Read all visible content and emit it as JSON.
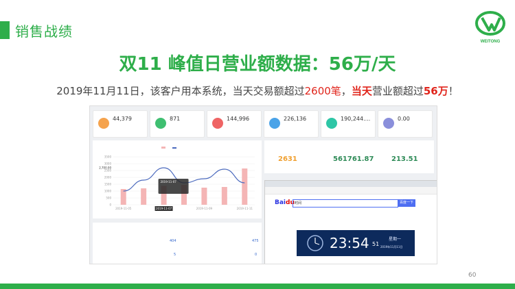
{
  "header": {
    "title": "销售战绩"
  },
  "logo": {
    "text": "WEITONG"
  },
  "main": {
    "title": "双11 峰值日营业额数据：56万/天",
    "subtitle": {
      "part1": "2019年11月11日，该客户用本系统，当天交易额超过",
      "hl1": "2600笔",
      "part2": "，",
      "hl2": "当天",
      "part3": "营业额超过",
      "hl3": "56万",
      "part4": "！"
    }
  },
  "stats": [
    {
      "value": "44,379",
      "color": "#f5a34d",
      "icon": "user-icon"
    },
    {
      "value": "871",
      "color": "#3fbf71",
      "icon": "member-icon"
    },
    {
      "value": "144,996",
      "color": "#ef6464",
      "icon": "order-icon"
    },
    {
      "value": "226,136",
      "color": "#4aa3e8",
      "icon": "bag-icon"
    },
    {
      "value": "190,244....",
      "color": "#2ec6a6",
      "icon": "money-icon"
    },
    {
      "value": "0.00",
      "color": "#8a8fdb",
      "icon": "shield-icon"
    }
  ],
  "chart_data": {
    "type": "bar",
    "categories": [
      "2019-11-05",
      "",
      "2019-11-07",
      "",
      "2019-11-09",
      "",
      "2019-11-11"
    ],
    "series": [
      {
        "values": [
          1150,
          1200,
          1380,
          1450,
          1250,
          1300,
          2650
        ]
      },
      {
        "values": [
          1000,
          1800,
          2700,
          1600,
          1900,
          2600,
          1600
        ]
      }
    ],
    "tooltip": {
      "date": "2019-11-07"
    },
    "yticks": [
      "3500",
      "3000",
      "2500",
      "2000",
      "1500",
      "1000",
      "500",
      "0"
    ],
    "ylim": [
      0,
      3500
    ],
    "highlight_label": "2,700.00"
  },
  "right_panel": {
    "v1": "2631",
    "v2": "561761.87",
    "v3": "213.51"
  },
  "browser": {
    "search_text": "时间",
    "search_button": "百度一下",
    "clock": "23:54",
    "seconds": "51",
    "date_line1": "星期一",
    "date_line2": "2019年11月11日"
  },
  "lower_panel": {
    "v1": "404",
    "v2": "475",
    "v3": "5",
    "v4": "0"
  },
  "page_number": "60"
}
